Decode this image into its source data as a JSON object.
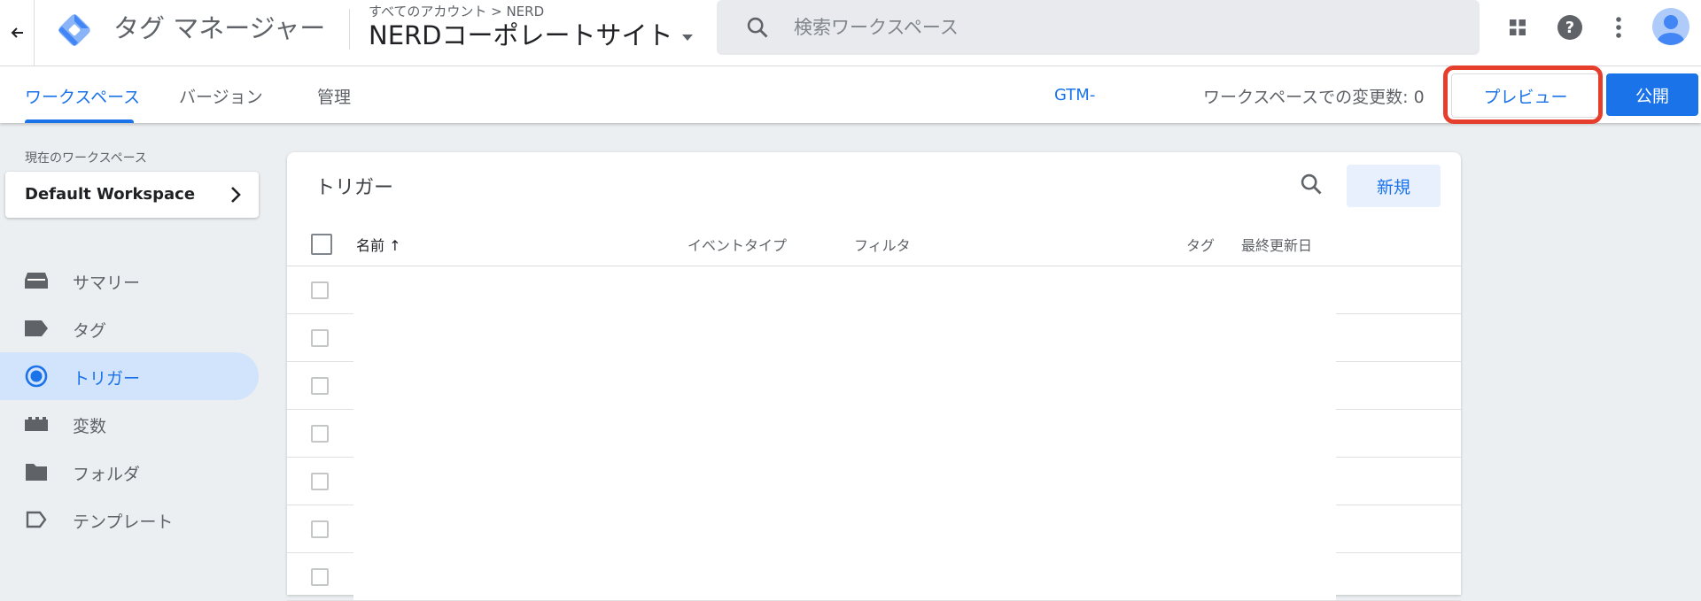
{
  "header": {
    "app_name": "タグ マネージャー",
    "breadcrumb": "すべてのアカウント > NERD",
    "container_name": "NERDコーポレートサイト",
    "search_placeholder": "検索ワークスペース"
  },
  "tabs": [
    {
      "label": "ワークスペース",
      "active": true
    },
    {
      "label": "バージョン",
      "active": false
    },
    {
      "label": "管理",
      "active": false
    }
  ],
  "toolbar": {
    "container_id": "GTM-",
    "changes_text": "ワークスペースでの変更数: 0",
    "preview_label": "プレビュー",
    "publish_label": "公開"
  },
  "workspace": {
    "label": "現在のワークスペース",
    "name": "Default Workspace"
  },
  "sidebar": {
    "items": [
      {
        "label": "サマリー",
        "icon": "summary-icon",
        "active": false
      },
      {
        "label": "タグ",
        "icon": "tag-icon",
        "active": false
      },
      {
        "label": "トリガー",
        "icon": "trigger-icon",
        "active": true
      },
      {
        "label": "変数",
        "icon": "variable-icon",
        "active": false
      },
      {
        "label": "フォルダ",
        "icon": "folder-icon",
        "active": false
      },
      {
        "label": "テンプレート",
        "icon": "template-icon",
        "active": false
      }
    ]
  },
  "panel": {
    "title": "トリガー",
    "new_label": "新規",
    "columns": [
      "名前 ↑",
      "イベントタイプ",
      "フィルタ",
      "タグ",
      "最終更新日"
    ]
  },
  "colors": {
    "accent": "#1a73e8",
    "highlight": "#e53e2d",
    "active_nav_bg": "#d2e3fc"
  }
}
